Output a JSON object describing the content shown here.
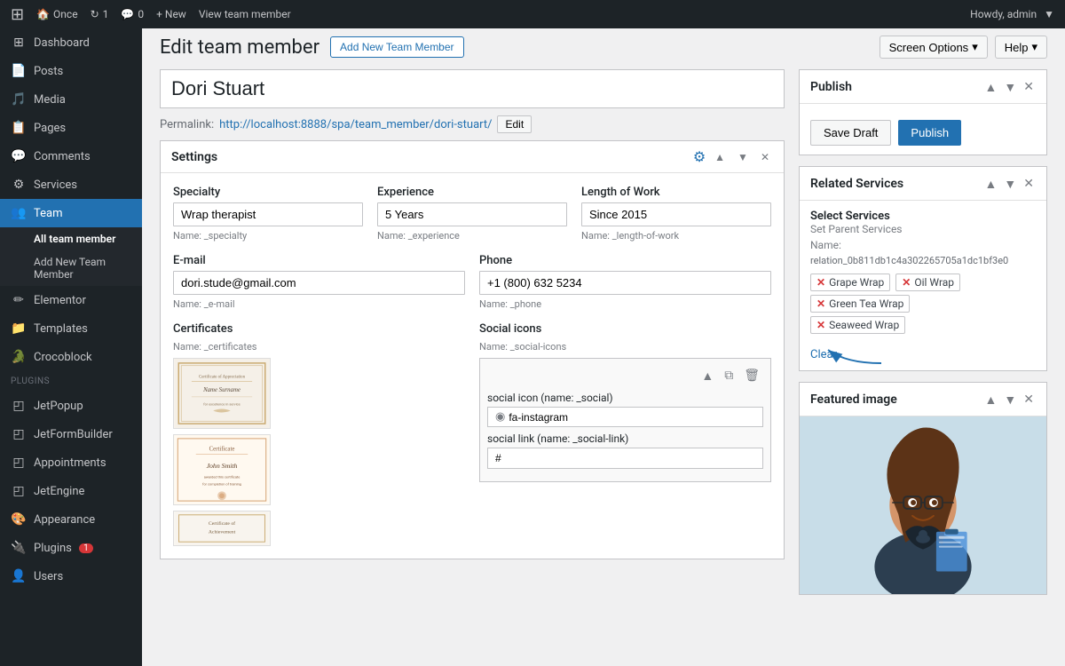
{
  "topbar": {
    "site_name": "Once",
    "updates_count": "1",
    "comments_count": "0",
    "new_label": "+ New",
    "view_label": "View team member",
    "howdy": "Howdy, admin"
  },
  "sidebar": {
    "items": [
      {
        "id": "dashboard",
        "label": "Dashboard",
        "icon": "⊞"
      },
      {
        "id": "posts",
        "label": "Posts",
        "icon": "📄"
      },
      {
        "id": "media",
        "label": "Media",
        "icon": "🎵"
      },
      {
        "id": "pages",
        "label": "Pages",
        "icon": "📋"
      },
      {
        "id": "comments",
        "label": "Comments",
        "icon": "💬"
      },
      {
        "id": "services",
        "label": "Services",
        "icon": "⚙"
      },
      {
        "id": "team",
        "label": "Team",
        "icon": "👥",
        "active": true
      }
    ],
    "team_submenu": [
      {
        "id": "all-team",
        "label": "All team member",
        "active": true
      },
      {
        "id": "add-new",
        "label": "Add New Team Member",
        "active": false
      }
    ],
    "other_items": [
      {
        "id": "elementor",
        "label": "Elementor",
        "icon": "✏"
      },
      {
        "id": "templates",
        "label": "Templates",
        "icon": "📁"
      },
      {
        "id": "crocoblock",
        "label": "Crocoblock",
        "icon": "🐊"
      }
    ],
    "plugins_label": "PLUGINS",
    "plugins": [
      {
        "id": "jetpopup",
        "label": "JetPopup",
        "icon": "◰"
      },
      {
        "id": "jetformbuilder",
        "label": "JetFormBuilder",
        "icon": "◰"
      },
      {
        "id": "appointments",
        "label": "Appointments",
        "icon": "◰"
      },
      {
        "id": "jetengine",
        "label": "JetEngine",
        "icon": "◰"
      }
    ],
    "bottom_items": [
      {
        "id": "appearance",
        "label": "Appearance",
        "icon": "🎨"
      },
      {
        "id": "plugins",
        "label": "Plugins",
        "icon": "🔌",
        "badge": "1"
      },
      {
        "id": "users",
        "label": "Users",
        "icon": "👤"
      }
    ]
  },
  "header": {
    "title": "Edit team member",
    "add_new_label": "Add New Team Member",
    "screen_options": "Screen Options",
    "help": "Help"
  },
  "form": {
    "name_value": "Dori Stuart",
    "permalink_label": "Permalink:",
    "permalink_url": "http://localhost:8888/spa/team_member/dori-stuart/",
    "edit_label": "Edit",
    "settings_title": "Settings",
    "specialty_label": "Specialty",
    "specialty_value": "Wrap therapist",
    "specialty_name": "Name: _specialty",
    "experience_label": "Experience",
    "experience_value": "5 Years",
    "experience_name": "Name: _experience",
    "length_label": "Length of Work",
    "length_value": "Since 2015",
    "length_name": "Name: _length-of-work",
    "email_label": "E-mail",
    "email_value": "dori.stude@gmail.com",
    "email_name": "Name: _e-mail",
    "phone_label": "Phone",
    "phone_value": "+1 (800) 632 5234",
    "phone_name": "Name: _phone",
    "certificates_label": "Certificates",
    "certificates_name": "Name: _certificates",
    "social_label": "Social icons",
    "social_name": "Name: _social-icons",
    "social_icon_label": "social icon (name: _social)",
    "social_icon_value": "fa-instagram",
    "social_link_label": "social link (name: _social-link)",
    "social_link_value": "#"
  },
  "related_services": {
    "title": "Related Services",
    "select_label": "Select Services",
    "set_parent_label": "Set Parent Services",
    "name_label": "Name:",
    "name_value": "relation_0b811db1c4a302265705a1dc1bf3e0",
    "tags": [
      {
        "label": "Grape Wrap"
      },
      {
        "label": "Oil Wrap"
      },
      {
        "label": "Green Tea Wrap"
      },
      {
        "label": "Seaweed Wrap"
      }
    ],
    "clear_label": "Clear"
  },
  "publish": {
    "title": "Publish",
    "save_draft": "Save Draft",
    "publish": "Publish"
  },
  "featured_image": {
    "title": "Featured image"
  }
}
